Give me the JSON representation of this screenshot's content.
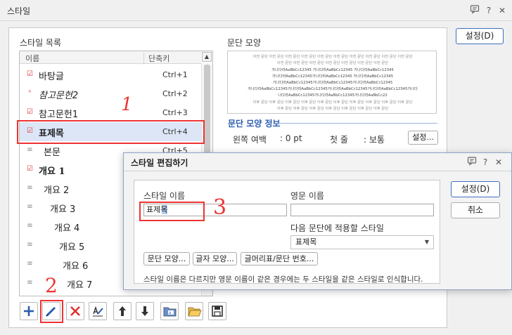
{
  "window": {
    "title": "스타일",
    "help_glyph": "?",
    "close_glyph": "✕"
  },
  "list": {
    "label": "스타일 목록",
    "col_name": "이름",
    "col_shortcut": "단축키",
    "items": [
      {
        "name": "바탕글",
        "shortcut": "Ctrl+1"
      },
      {
        "name": "참고문헌2",
        "shortcut": "Ctrl+2"
      },
      {
        "name": "참고문헌1",
        "shortcut": "Ctrl+3"
      },
      {
        "name": "표제목",
        "shortcut": "Ctrl+4"
      },
      {
        "name": "본문",
        "shortcut": "Ctrl+5"
      },
      {
        "name": "개요 1",
        "shortcut": ""
      },
      {
        "name": "개요 2",
        "shortcut": ""
      },
      {
        "name": "개요 3",
        "shortcut": ""
      },
      {
        "name": "개요 4",
        "shortcut": ""
      },
      {
        "name": "개요 5",
        "shortcut": ""
      },
      {
        "name": "개요 6",
        "shortcut": ""
      },
      {
        "name": "개요 7",
        "shortcut": ""
      }
    ]
  },
  "preview": {
    "label": "문단 모양",
    "lines": [
      "이전 문단 이전 문단 이전 문단 이전 문단 이전 문단 이전 문단 이전 문단 이전 문단 이전 문단 이전 문단",
      "이전 문단 이전 문단 이전 문단 이전 문단 이전 문단 이전 문단 이전 문단",
      "가나다라AaBbCc12345 가나다라AaBbCc12345 가나다라AaBbCc12345",
      "가나다라AaBbCc12345가나다라AaBbCc12345 가나다라AaBbCc12345",
      "가나다라AaBbCc12345가나다라AaBbCc12345가나다라AaBbCc12345",
      "가나다라AaBbCc12345가나다라AaBbCc12345가나다라AaBbCc12345가나다라AaBbCc12345가나다",
      "나다라AaBbCc12345가나다라AaBbCc12345가나다라AaBbCc22",
      "이후 문단 이후 문단 이후 문단 이후 문단 이후 문단 이후 문단 이후 문단 이후 문단 이후 문단 이후 문단",
      "이후 문단 이후 문단 이후 문단 이후 문단 이후 문단 이후 문단 이후 문단"
    ]
  },
  "info": {
    "title": "문단 모양 정보",
    "left_margin_label": "왼쪽 여백",
    "left_margin_value": ": 0 pt",
    "first_line_label": "첫 줄",
    "first_line_value": ": 보통",
    "settings_button": "설정..."
  },
  "side": {
    "settings_button": "설정(D)"
  },
  "toolbar": {
    "add": "add",
    "edit": "edit",
    "delete": "delete"
  },
  "dialog": {
    "title": "스타일 편집하기",
    "help_glyph": "?",
    "close_glyph": "✕",
    "style_name_label": "스타일 이름",
    "style_name_value": "표제목",
    "english_name_label": "영문 이름",
    "english_name_value": "",
    "next_style_label": "다음 문단에 적용할 스타일",
    "next_style_value": "표제목",
    "para_shape_button": "문단 모양...",
    "char_shape_button": "글자 모양...",
    "bullet_button": "글머리표/문단 번호...",
    "note": "스타일 이름은 다르지만 영문 이름이 같은 경우에는 두 스타일을 같은 스타일로 인식합니다.",
    "settings_button": "설정(D)",
    "cancel_button": "취소"
  },
  "annotations": {
    "mark1": "1",
    "mark2": "2",
    "mark3": "3"
  },
  "colors": {
    "accent": "#2a5db0",
    "annotation_red": "#e33333",
    "selection": "#dce6f7"
  }
}
